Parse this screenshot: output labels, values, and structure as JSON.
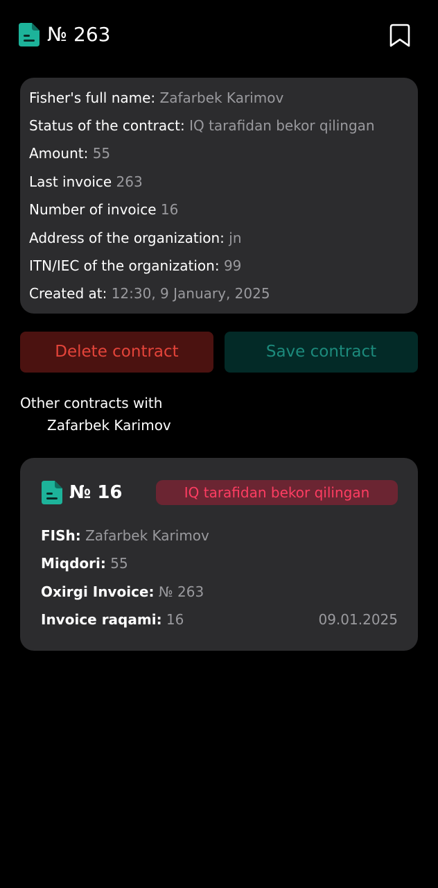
{
  "header": {
    "title": "№ 263",
    "doc_icon": "document-icon",
    "bookmark_icon": "bookmark-icon"
  },
  "details": {
    "fisher_label": "Fisher's full name:",
    "fisher_value": "Zafarbek Karimov",
    "status_label": "Status of the contract:",
    "status_value": "IQ tarafidan bekor qilingan",
    "amount_label": "Amount:",
    "amount_value": "55",
    "last_invoice_label": "Last invoice",
    "last_invoice_value": "263",
    "invoice_number_label": "Number of invoice",
    "invoice_number_value": "16",
    "address_label": "Address of the organization:",
    "address_value": "jn",
    "itn_label": "ITN/IEC of the organization:",
    "itn_value": "99",
    "created_label": "Created at:",
    "created_value": "12:30, 9 January, 2025"
  },
  "actions": {
    "delete_label": "Delete contract",
    "save_label": "Save contract"
  },
  "other": {
    "title_line1": "Other contracts with",
    "title_line2": "Zafarbek Karimov"
  },
  "contracts": [
    {
      "number": "№ 16",
      "status": "IQ tarafidan bekor qilingan",
      "fish_label": "FISh:",
      "fish_value": "Zafarbek Karimov",
      "miqdori_label": "Miqdori:",
      "miqdori_value": "55",
      "oxirgi_label": "Oxirgi Invoice:",
      "oxirgi_value": "№ 263",
      "raqami_label": "Invoice raqami:",
      "raqami_value": "16",
      "date": "09.01.2025"
    }
  ],
  "colors": {
    "accent_teal": "#1db39a",
    "delete_red": "#e4443a",
    "status_pink": "#ff3d62"
  }
}
